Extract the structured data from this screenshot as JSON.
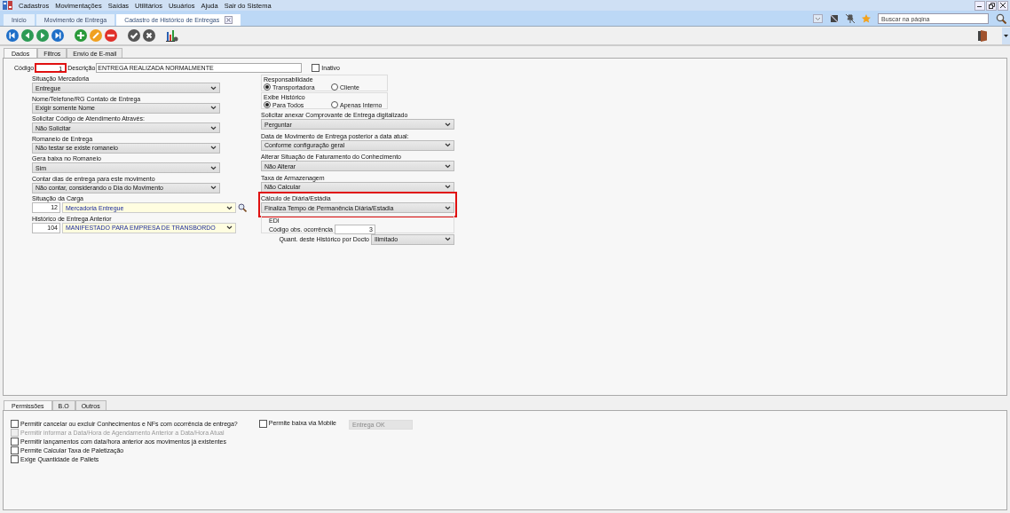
{
  "menu": [
    "Cadastros",
    "Movimentações",
    "Saídas",
    "Utilitários",
    "Usuários",
    "Ajuda",
    "Sair do Sistema"
  ],
  "page_tabs": [
    {
      "label": "Início",
      "selected": false,
      "closable": false
    },
    {
      "label": "Movimento de Entrega",
      "selected": false,
      "closable": false
    },
    {
      "label": "Cadastro de Histórico de Entregas",
      "selected": true,
      "closable": true
    }
  ],
  "search": {
    "placeholder": "Buscar na página"
  },
  "form_tabs": [
    {
      "label": "Dados",
      "selected": true
    },
    {
      "label": "Filtros",
      "selected": false
    },
    {
      "label": "Envio de E-mail",
      "selected": false
    }
  ],
  "codigo": {
    "label": "Código",
    "value": "1",
    "highlighted": true
  },
  "descricao": {
    "label": "Descrição",
    "value": "ENTREGA REALIZADA NORMALMENTE"
  },
  "inativo": {
    "label": "Inativo",
    "checked": false
  },
  "left_fields": [
    {
      "kind": "select",
      "label": "Situação Mercadoria",
      "value": "Entregue"
    },
    {
      "kind": "select",
      "label": "Nome/Telefone/RG Contato de Entrega",
      "value": "Exigir somente Nome"
    },
    {
      "kind": "select",
      "label": "Solicitar Código de Atendimento Através:",
      "value": "Não Solicitar"
    },
    {
      "kind": "select",
      "label": "Romaneio de Entrega",
      "value": "Não testar se existe romaneio"
    },
    {
      "kind": "select",
      "label": "Gera baixa no Romaneio",
      "value": "Sim"
    },
    {
      "kind": "select",
      "label": "Contar dias de entrega para este movimento",
      "value": "Não contar, considerando o Dia do Movimento"
    },
    {
      "kind": "lookup",
      "label": "Situação da Carga",
      "code": "12",
      "value": "Mercadoria Entregue",
      "search": true
    },
    {
      "kind": "lookup",
      "label": "Histórico de Entrega Anterior",
      "code": "104",
      "value": "MANIFESTADO PARA EMPRESA DE TRANSBORDO",
      "search": false
    }
  ],
  "radio_groups": [
    {
      "label": "Responsabilidade",
      "options": [
        {
          "label": "Transportadora",
          "selected": true
        },
        {
          "label": "Cliente",
          "selected": false
        }
      ]
    },
    {
      "label": "Exibe Histórico",
      "options": [
        {
          "label": "Para Todos",
          "selected": true
        },
        {
          "label": "Apenas Interno",
          "selected": false
        }
      ]
    }
  ],
  "right_fields": [
    {
      "label": "Solicitar anexar Comprovante de Entrega digitalizado",
      "value": "Perguntar",
      "highlighted": false
    },
    {
      "label": "Data de Movimento de Entrega posterior a data atual:",
      "value": "Conforme configuração geral",
      "highlighted": false
    },
    {
      "label": "Alterar Situação de Faturamento do Conhecimento",
      "value": "Não Alterar",
      "highlighted": false
    },
    {
      "label": "Taxa de Armazenagem",
      "value": "Não Calcular",
      "highlighted": false
    },
    {
      "label": "Cálculo de Diária/Estádia",
      "value": "Finaliza Tempo de Permanência Diária/Estadia",
      "highlighted": true
    }
  ],
  "edi": {
    "label": "EDI",
    "field_label": "Código obs. ocorrência",
    "value": "3"
  },
  "quant": {
    "label": "Quant. deste Histórico por Docto",
    "value": "Ilimitado"
  },
  "bottom_tabs": [
    {
      "label": "Permissões",
      "selected": true
    },
    {
      "label": "B.O",
      "selected": false
    },
    {
      "label": "Outros",
      "selected": false
    }
  ],
  "permissions": [
    {
      "label": "Permitir cancelar ou excluir Conhecimentos e NFs com ocorrência de entrega?",
      "checked": false,
      "disabled": false
    },
    {
      "label": "Permitir informar a Data/Hora de Agendamento Anterior a Data/Hora Atual",
      "checked": false,
      "disabled": true
    },
    {
      "label": "Permitir lançamentos com data/hora anterior aos movimentos já existentes",
      "checked": false,
      "disabled": false
    },
    {
      "label": "Permite Calcular Taxa de Paletização",
      "checked": false,
      "disabled": false
    },
    {
      "label": "Exige Quantidade de Pallets",
      "checked": false,
      "disabled": false
    }
  ],
  "mobile": {
    "label": "Permite baixa via Mobile",
    "checked": false,
    "value": "Entrega OK"
  }
}
